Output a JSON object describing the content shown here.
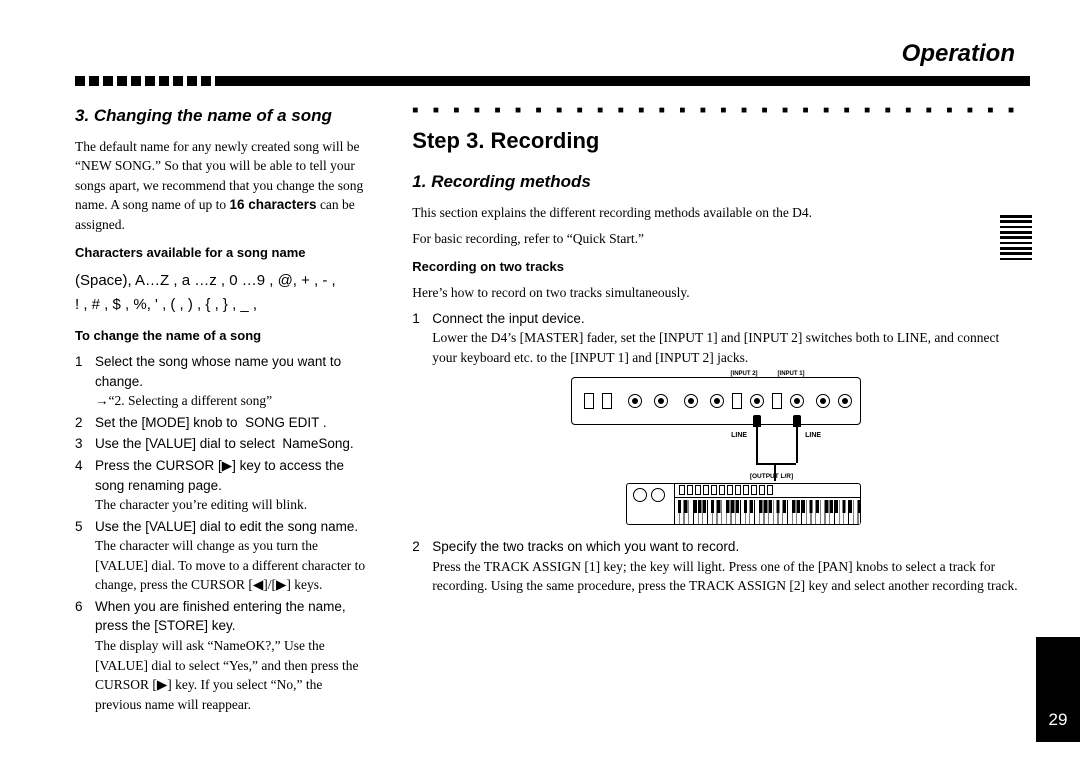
{
  "header": {
    "title": "Operation"
  },
  "left": {
    "section_title": "3. Changing the name of a song",
    "intro": "The default name for any newly created song will be “NEW SONG.” So that you will be able to tell your songs apart, we recommend that you change the song name. A song name of up to ",
    "intro_bold": "16 characters",
    "intro_tail": " can be assigned.",
    "chars_label": "Characters available for a song name",
    "chars_line1": "(Space), A…Z , a …z , 0 …9 , @, + , - ,",
    "chars_line2": "! , # , $ , %, ' , ( , ) , { , } , _ ,",
    "howto_label": "To change the name of a song",
    "steps": [
      {
        "n": "1",
        "lead": "Select the song whose name you want to change.",
        "detail": "→“2. Selecting a different song”"
      },
      {
        "n": "2",
        "lead": "Set the [MODE] knob to  SONG EDIT .",
        "detail": ""
      },
      {
        "n": "3",
        "lead": "Use the [VALUE] dial to select  NameSong.",
        "detail": ""
      },
      {
        "n": "4",
        "lead": "Press the CURSOR [▶] key to access the song renaming page.",
        "detail": "The character you’re editing will blink."
      },
      {
        "n": "5",
        "lead": "Use the [VALUE] dial to edit the song name.",
        "detail": "The character will change as you turn the [VALUE] dial. To move to a different character to change, press the CURSOR [◀]/[▶] keys."
      },
      {
        "n": "6",
        "lead": "When you are ﬁnished entering the name, press the [STORE] key.",
        "detail": "The display will ask “NameOK?,” Use the [VALUE] dial to select “Yes,” and then press the CURSOR [▶] key. If you select “No,” the previous name will reappear."
      }
    ]
  },
  "right": {
    "step_heading": "Step 3. Recording",
    "section_title": "1. Recording methods",
    "intro1": "This section explains the different recording methods available on the D4.",
    "intro2": "For basic recording, refer to “Quick Start.”",
    "sub_label": "Recording on two tracks",
    "sub_intro": "Here’s how to record on two tracks simultaneously.",
    "step1_lead": "Connect the input device.",
    "step1_detail": "Lower the D4’s [MASTER] fader, set the [INPUT 1] and [INPUT 2] switches both to LINE, and connect your keyboard etc. to the [INPUT 1] and [INPUT 2] jacks.",
    "diagram": {
      "in1": "[INPUT 1]",
      "in2": "[INPUT 2]",
      "line": "LINE",
      "out": "[OUTPUT L/R]"
    },
    "step2_lead": "Specify the two tracks on which you want to record.",
    "step2_detail": "Press the TRACK ASSIGN [1] key; the key will light. Press one of the [PAN] knobs to select a track for recording. Using the same procedure, press the TRACK ASSIGN [2] key and select another recording track."
  },
  "page_number": "29"
}
